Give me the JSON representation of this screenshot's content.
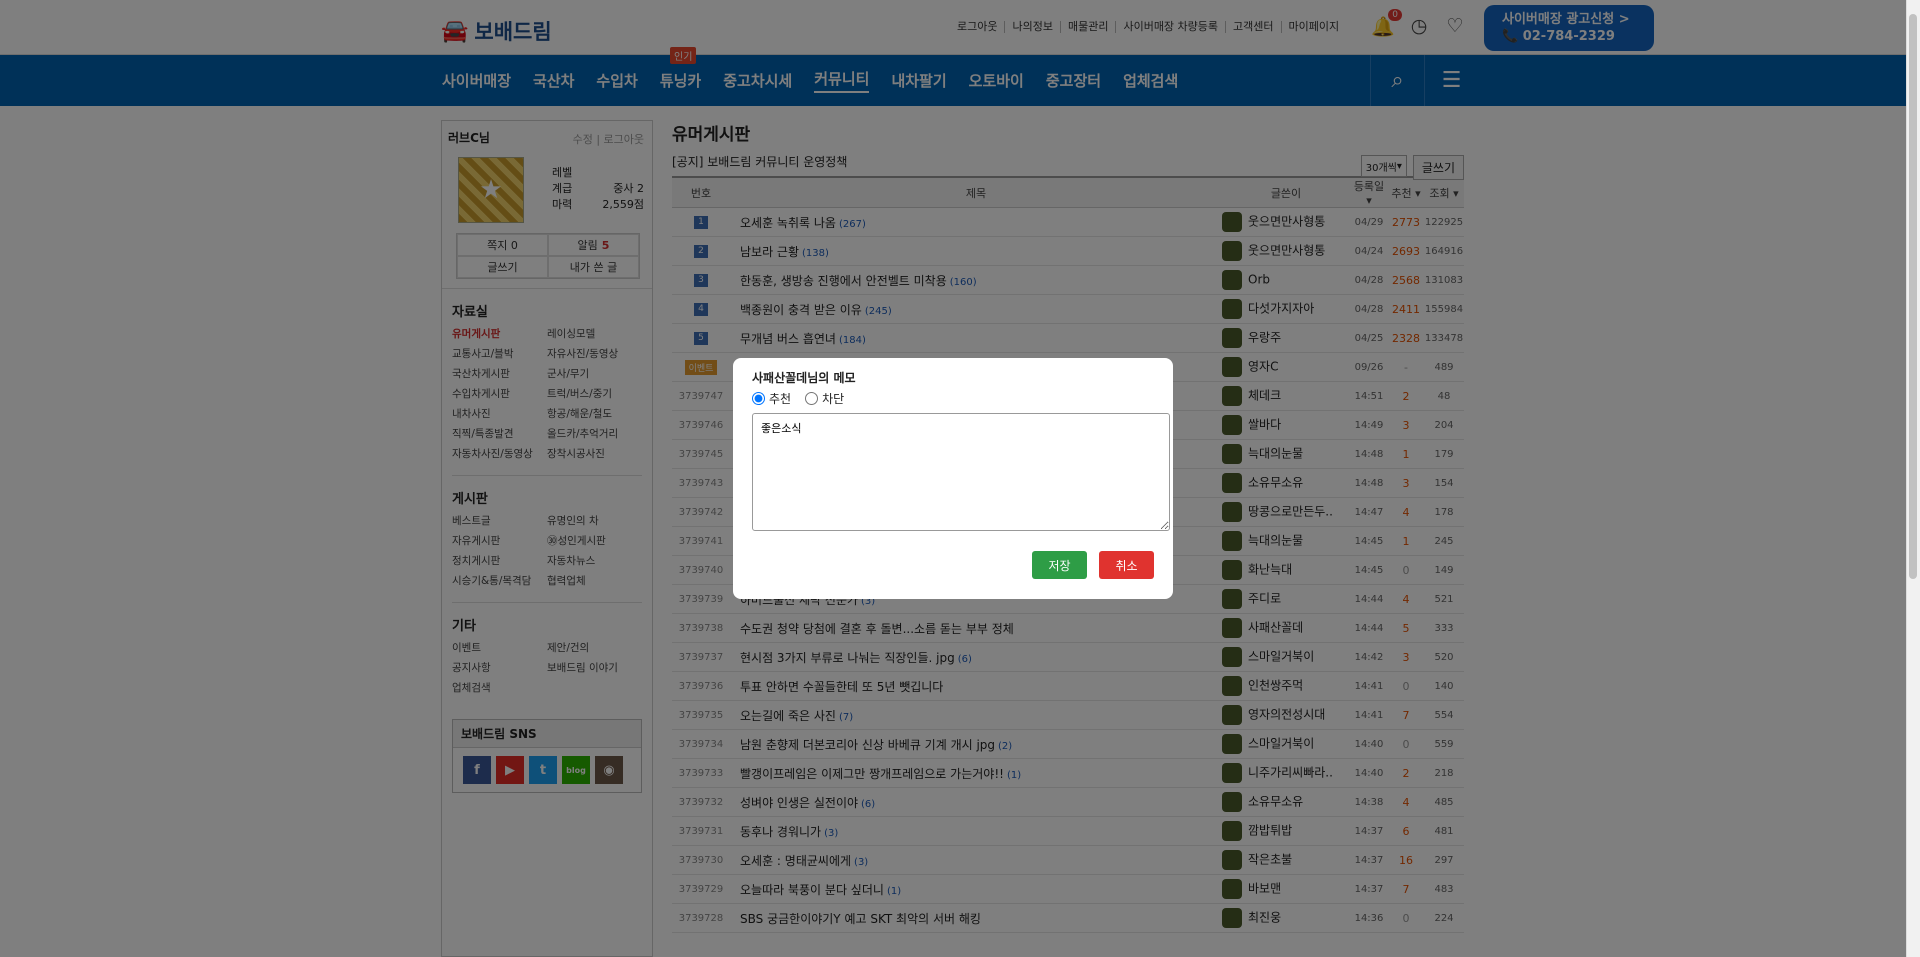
{
  "header": {
    "logo": "보배드림",
    "links": [
      "로그아웃",
      "나의정보",
      "매물관리",
      "사이버매장 차량등록",
      "고객센터",
      "마이페이지"
    ],
    "notification_count": "0",
    "ad_line1": "사이버매장 광고신청 >",
    "ad_line2": "02-784-2329"
  },
  "nav": {
    "items": [
      "사이버매장",
      "국산차",
      "수입차",
      "튜닝카",
      "중고차시세",
      "커뮤니티",
      "내차팔기",
      "오토바이",
      "중고장터",
      "업체검색"
    ],
    "hot_label": "인기"
  },
  "sidebar": {
    "nick": "러브C님",
    "edit": "수정 | 로그아웃",
    "level_label": "레벨",
    "grade_label": "계급",
    "grade_value": "중사 2",
    "power_label": "마력",
    "power_value": "2,559점",
    "btn_note": "쪽지 0",
    "btn_alarm": "알림",
    "alarm_count": "5",
    "btn_write": "글쓰기",
    "btn_mywrite": "내가 쓴 글",
    "sections": [
      {
        "title": "자료실",
        "items": [
          "유머게시판",
          "레이싱모델",
          "교통사고/블박",
          "자유사진/동영상",
          "국산차게시판",
          "군사/무기",
          "수입차게시판",
          "트럭/버스/중기",
          "내차사진",
          "항공/해운/철도",
          "직찍/특종발견",
          "올드카/추억거리",
          "자동차사진/동영상",
          "장착시공사진"
        ]
      },
      {
        "title": "게시판",
        "items": [
          "베스트글",
          "유명인의 차",
          "자유게시판",
          "㉚성인게시판",
          "정치게시판",
          "자동차뉴스",
          "시승기&통/목격담",
          "협력업체"
        ]
      },
      {
        "title": "기타",
        "items": [
          "이벤트",
          "제안/건의",
          "공지사항",
          "보배드림 이야기",
          "업체검색",
          ""
        ]
      }
    ],
    "sns_title": "보배드림 SNS"
  },
  "board": {
    "title": "유머게시판",
    "notice": "[공지] 보배드림 커뮤니티 운영정책",
    "per_page": "30개씩",
    "write_btn": "글쓰기",
    "columns": [
      "번호",
      "제목",
      "글쓴이",
      "등록일 ▾",
      "추천 ▾",
      "조회 ▾"
    ],
    "rows": [
      {
        "no": "1",
        "title": "오세훈 녹취록 나옴",
        "cnt": "(267)",
        "author": "웃으면만사형통",
        "date": "04/29",
        "rec": "2773",
        "views": "122925"
      },
      {
        "no": "2",
        "title": "남보라 근황",
        "cnt": "(138)",
        "author": "웃으면만사형통",
        "date": "04/24",
        "rec": "2693",
        "views": "164916"
      },
      {
        "no": "3",
        "title": "한동훈, 생방송 진행에서 안전벨트 미착용",
        "cnt": "(160)",
        "author": "Orb",
        "date": "04/28",
        "rec": "2568",
        "views": "131083"
      },
      {
        "no": "4",
        "title": "백종원이 충격 받은 이유",
        "cnt": "(245)",
        "author": "다섯가지자아",
        "date": "04/28",
        "rec": "2411",
        "views": "155984"
      },
      {
        "no": "5",
        "title": "무개념 버스 흡연녀",
        "cnt": "(184)",
        "author": "우랑주",
        "date": "04/25",
        "rec": "2328",
        "views": "133478"
      },
      {
        "no": "이벤트",
        "title": "",
        "cnt": "",
        "author": "영자C",
        "date": "09/26",
        "rec": "-",
        "views": "489"
      },
      {
        "no": "3739747",
        "title": "",
        "cnt": "",
        "author": "체데크",
        "date": "14:51",
        "rec": "2",
        "views": "48"
      },
      {
        "no": "3739746",
        "title": "",
        "cnt": "",
        "author": "쌀바다",
        "date": "14:49",
        "rec": "3",
        "views": "204"
      },
      {
        "no": "3739745",
        "title": "",
        "cnt": "",
        "author": "늑대의눈물",
        "date": "14:48",
        "rec": "1",
        "views": "179"
      },
      {
        "no": "3739743",
        "title": "",
        "cnt": "",
        "author": "소유무소유",
        "date": "14:48",
        "rec": "3",
        "views": "154"
      },
      {
        "no": "3739742",
        "title": "",
        "cnt": "",
        "author": "땅콩으로만든두..",
        "date": "14:47",
        "rec": "4",
        "views": "178"
      },
      {
        "no": "3739741",
        "title": "",
        "cnt": "",
        "author": "늑대의눈물",
        "date": "14:45",
        "rec": "1",
        "views": "245"
      },
      {
        "no": "3739740",
        "title": "",
        "cnt": "",
        "author": "화난늑대",
        "date": "14:45",
        "rec": "0",
        "views": "149"
      },
      {
        "no": "3739739",
        "title": "하버드출신 세탁 전문가",
        "cnt": "(3)",
        "author": "주디로",
        "date": "14:44",
        "rec": "4",
        "views": "521"
      },
      {
        "no": "3739738",
        "title": "수도권 청약 당첨에 결혼 후 돌변...소름 돋는 부부 정체",
        "cnt": "",
        "author": "사패산꼴데",
        "date": "14:44",
        "rec": "5",
        "views": "333"
      },
      {
        "no": "3739737",
        "title": "현시점 3가지 부류로 나눠는 직장인들. jpg",
        "cnt": "(6)",
        "author": "스마일거북이",
        "date": "14:42",
        "rec": "3",
        "views": "520"
      },
      {
        "no": "3739736",
        "title": "투표 안하면 수꼴들한테 또 5년 뺏깁니다",
        "cnt": "",
        "author": "인천쌍주먹",
        "date": "14:41",
        "rec": "0",
        "views": "140"
      },
      {
        "no": "3739735",
        "title": "오는길에 죽은 사진",
        "cnt": "(7)",
        "author": "영자의전성시대",
        "date": "14:41",
        "rec": "7",
        "views": "554"
      },
      {
        "no": "3739734",
        "title": "남원 춘향제 더본코리아 신상 바베큐 기계 개시 jpg",
        "cnt": "(2)",
        "author": "스마일거북이",
        "date": "14:40",
        "rec": "0",
        "views": "559"
      },
      {
        "no": "3739733",
        "title": "빨갱이프레임은 이제그만 짱개프레임으로 가는거야!!",
        "cnt": "(1)",
        "author": "니주가리씨빠라..",
        "date": "14:40",
        "rec": "2",
        "views": "218"
      },
      {
        "no": "3739732",
        "title": "성벼야 인생은 실전이야",
        "cnt": "(6)",
        "author": "소유무소유",
        "date": "14:38",
        "rec": "4",
        "views": "485"
      },
      {
        "no": "3739731",
        "title": "동후나 경워니가",
        "cnt": "(3)",
        "author": "깜밥튀밥",
        "date": "14:37",
        "rec": "6",
        "views": "481"
      },
      {
        "no": "3739730",
        "title": "오세훈 : 명태균씨에게",
        "cnt": "(3)",
        "author": "작은초불",
        "date": "14:37",
        "rec": "16",
        "views": "297"
      },
      {
        "no": "3739729",
        "title": "오늘따라 북풍이 분다 싶더니",
        "cnt": "(1)",
        "author": "바보맨",
        "date": "14:37",
        "rec": "7",
        "views": "483"
      },
      {
        "no": "3739728",
        "title": "SBS 궁금한이야기Y 예고 SKT 최악의 서버 해킹",
        "cnt": "",
        "author": "최진웅",
        "date": "14:36",
        "rec": "0",
        "views": "224"
      }
    ]
  },
  "modal": {
    "title": "사패산꼴데님의 메모",
    "radio_recommend": "추천",
    "radio_block": "차단",
    "memo_text": "좋은소식",
    "save": "저장",
    "cancel": "취소"
  },
  "colors": {
    "nav_bg": "#0062b0",
    "save_btn": "#2e9d46",
    "cancel_btn": "#e0332f",
    "recommend_count": "#e65100"
  }
}
